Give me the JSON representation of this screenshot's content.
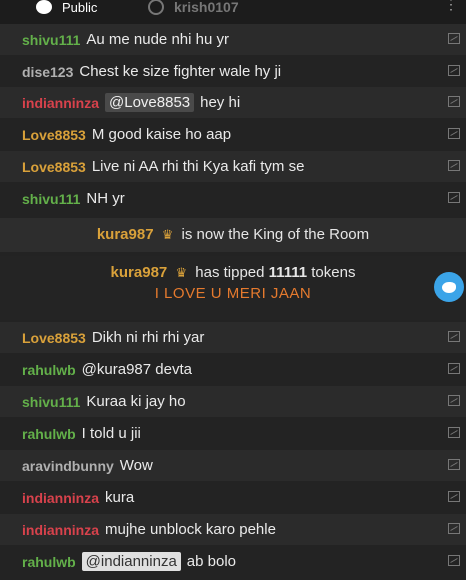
{
  "tabs": {
    "public_label": "Public",
    "user_label": "krish0107"
  },
  "messages_top": [
    {
      "user": "shivu111",
      "text": "Au me nude nhi hu yr"
    },
    {
      "user": "dise123",
      "text": "Chest ke size fighter wale hy ji"
    },
    {
      "user": "indianninza",
      "mention": "@Love8853",
      "text": "hey hi"
    },
    {
      "user": "Love8853",
      "text": "M good kaise ho aap"
    },
    {
      "user": "Love8853",
      "text": "Live ni AA rhi thi Kya kafi tym se"
    },
    {
      "user": "shivu111",
      "text": "NH yr"
    }
  ],
  "system_king": {
    "user": "kura987",
    "text": "is now the King of the Room"
  },
  "system_tip": {
    "user": "kura987",
    "prefix": "has tipped",
    "amount": "11111",
    "suffix": "tokens",
    "message": "I LOVE U MERI JAAN"
  },
  "messages_bottom": [
    {
      "user": "Love8853",
      "text": "Dikh ni rhi rhi yar"
    },
    {
      "user": "rahulwb",
      "text": "@kura987  devta"
    },
    {
      "user": "shivu111",
      "text": "Kuraa ki jay ho"
    },
    {
      "user": "rahulwb",
      "text": "I told u jii"
    },
    {
      "user": "aravindbunny",
      "text": "Wow"
    },
    {
      "user": "indianninza",
      "text": "kura"
    },
    {
      "user": "indianninza",
      "text": "mujhe unblock karo pehle"
    },
    {
      "user": "rahulwb",
      "mention": "@indianninza",
      "text": "ab bolo"
    }
  ],
  "colors": {
    "green_user": "#63b04a",
    "gray_user": "#b0b0b0",
    "red_user": "#d8424c",
    "gold_user": "#d9a13a",
    "tip_message": "#e57a2e",
    "twitter": "#3ba4e8"
  },
  "icons": {
    "report": "flag-icon",
    "crown": "crown-icon",
    "twitter": "twitter-icon"
  }
}
